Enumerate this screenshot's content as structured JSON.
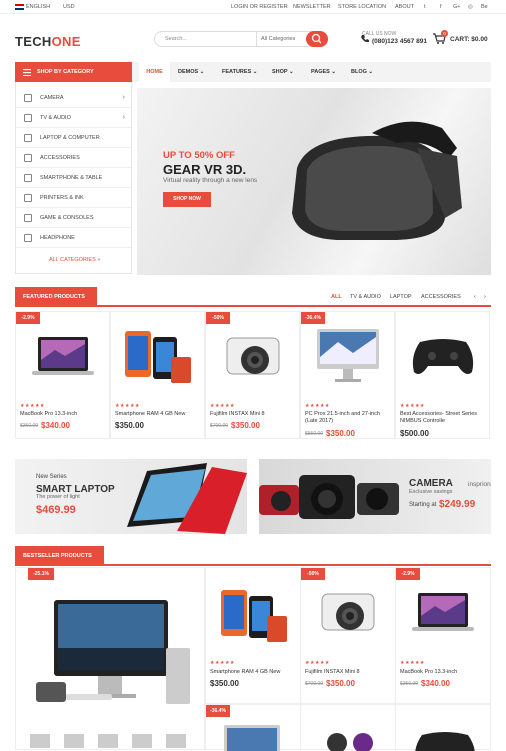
{
  "topbar": {
    "language": "ENGLISH",
    "currency": "USD",
    "links": [
      "LOGIN OR REGISTER",
      "NEWSLETTER",
      "STORE LOCATION",
      "ABOUT"
    ],
    "social": [
      "t",
      "f",
      "G+",
      "◎",
      "Be"
    ]
  },
  "header": {
    "logo_a": "TECH",
    "logo_b": "ONE",
    "search_placeholder": "Search...",
    "search_category": "All Categories",
    "call_label": "CALL US NOW",
    "phone": "(080)123 4567 891",
    "cart_label": "CART: $0.00",
    "cart_count": "0"
  },
  "nav": {
    "shop_by": "SHOP BY CATEGORY",
    "items": [
      "HOME",
      "DEMOS",
      "FEATURES",
      "SHOP",
      "PAGES",
      "BLOG"
    ]
  },
  "categories": [
    "CAMERA",
    "TV & AUDIO",
    "LAPTOP & COMPUTER",
    "ACCESSORIES",
    "SMARTPHONE & TABLE",
    "PRINTERS & INK",
    "GAME & CONSOLES",
    "HEADPHONE"
  ],
  "all_categories": "ALL CATEGORIES",
  "hero": {
    "promo": "UP TO 50% OFF",
    "title": "GEAR VR 3D.",
    "subtitle": "Virtual reality through a new lens",
    "button": "SHOP NOW"
  },
  "featured": {
    "heading": "FEATURED PRODUCTS",
    "tabs": [
      "ALL",
      "TV & AUDIO",
      "LAPTOP",
      "ACCESSORIES"
    ],
    "products": [
      {
        "badge": "-2.9%",
        "name": "MacBook Pro 13.3-inch",
        "old": "$350.00",
        "price": "$340.00"
      },
      {
        "badge": "",
        "name": "Smartphone RAM 4 GB New",
        "old": "",
        "price": "$350.00"
      },
      {
        "badge": "-50%",
        "name": "Fujifilm INSTAX Mini 8",
        "old": "$700.00",
        "price": "$350.00"
      },
      {
        "badge": "-36.4%",
        "name": "PC Prox 21.5-inch and 27-inch (Late 2017)",
        "old": "$550.00",
        "price": "$350.00"
      },
      {
        "badge": "",
        "name": "Best Accessories- Street Series NIMBUS Controlle",
        "old": "",
        "price": "$500.00"
      }
    ]
  },
  "banners": {
    "left": {
      "kicker": "New Series",
      "title": "SMART LAPTOP",
      "sub": "The power of light",
      "price": "$469.99"
    },
    "right": {
      "title": "CAMERA",
      "title2": "insprion",
      "sub": "Exclusive savings",
      "starting": "Starting at",
      "price": "$249.99"
    }
  },
  "bestseller": {
    "heading": "BESTSELLER PRODUCTS",
    "big_badge": "-25.1%",
    "products": [
      {
        "badge": "",
        "name": "Smartphone RAM 4 GB New",
        "old": "",
        "price": "$350.00"
      },
      {
        "badge": "-50%",
        "name": "Fujifilm INSTAX Mini 8",
        "old": "$700.00",
        "price": "$350.00"
      },
      {
        "badge": "-2.9%",
        "name": "MacBook Pro 13.3-inch",
        "old": "$350.00",
        "price": "$340.00"
      }
    ],
    "row2_badge": "-36.4%"
  },
  "stars": "★★★★★",
  "colors": {
    "accent": "#e74c3c"
  }
}
